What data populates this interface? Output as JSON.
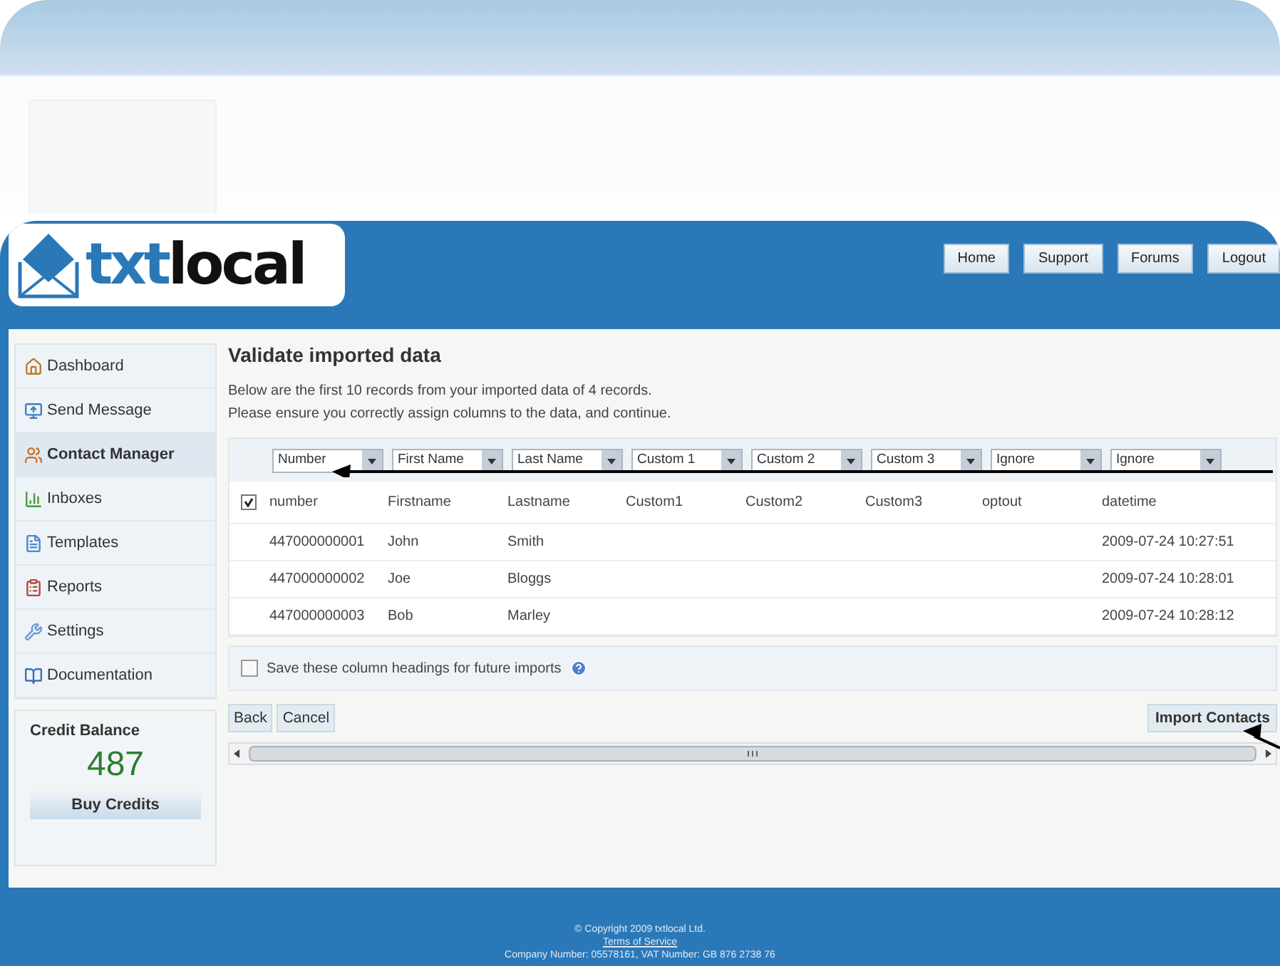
{
  "logo": {
    "part_one": "txt",
    "part_two": "local"
  },
  "top_nav": [
    "Home",
    "Support",
    "Forums",
    "Logout"
  ],
  "sidebar": {
    "items": [
      {
        "label": "Dashboard",
        "selected": false
      },
      {
        "label": "Send Message",
        "selected": false
      },
      {
        "label": "Contact Manager",
        "selected": true
      },
      {
        "label": "Inboxes",
        "selected": false
      },
      {
        "label": "Templates",
        "selected": false
      },
      {
        "label": "Reports",
        "selected": false
      },
      {
        "label": "Settings",
        "selected": false
      },
      {
        "label": "Documentation",
        "selected": false
      }
    ],
    "credit": {
      "title": "Credit Balance",
      "amount": "487",
      "button": "Buy Credits"
    }
  },
  "main": {
    "title": "Validate imported data",
    "description": [
      "Below are the first 10 records from your imported data of 4 records.",
      "Please ensure you correctly assign columns to the data, and continue."
    ],
    "column_selects": [
      "Number",
      "First Name",
      "Last Name",
      "Custom 1",
      "Custom 2",
      "Custom 3",
      "Ignore",
      "Ignore"
    ],
    "select_all_checked": true,
    "columns": [
      "number",
      "Firstname",
      "Lastname",
      "Custom1",
      "Custom2",
      "Custom3",
      "optout",
      "datetime"
    ],
    "rows": [
      [
        "447000000001",
        "John",
        "Smith",
        "",
        "",
        "",
        "",
        "2009-07-24 10:27:51"
      ],
      [
        "447000000002",
        "Joe",
        "Bloggs",
        "",
        "",
        "",
        "",
        "2009-07-24 10:28:01"
      ],
      [
        "447000000003",
        "Bob",
        "Marley",
        "",
        "",
        "",
        "",
        "2009-07-24 10:28:12"
      ]
    ],
    "save_headings": {
      "label": "Save these column headings for future imports",
      "checked": false
    },
    "buttons": [
      "Back",
      "Cancel"
    ],
    "import_button": "Import Contacts"
  },
  "footer": {
    "copyright": "© Copyright 2009 txtlocal Ltd.",
    "terms": "Terms of Service",
    "company": "Company Number: 05578161, VAT Number: GB 876 2738 76"
  }
}
